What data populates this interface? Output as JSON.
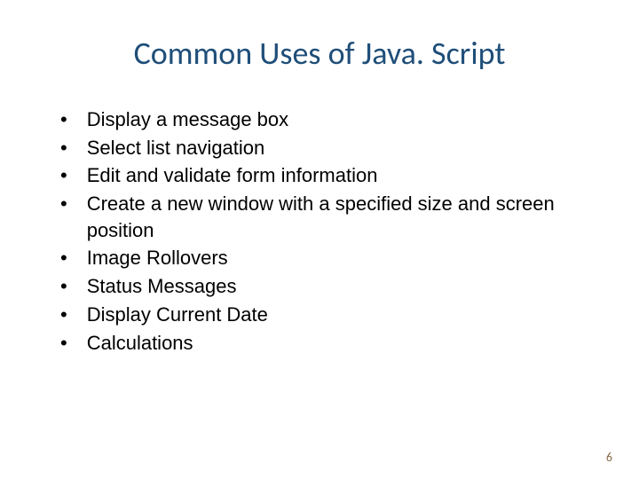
{
  "slide": {
    "title": "Common Uses of Java. Script",
    "bullets": [
      "Display a message box",
      "Select list navigation",
      "Edit and validate form information",
      "Create a new window with a specified size and screen position",
      "Image Rollovers",
      "Status Messages",
      "Display Current Date",
      "Calculations"
    ],
    "page_number": "6"
  }
}
